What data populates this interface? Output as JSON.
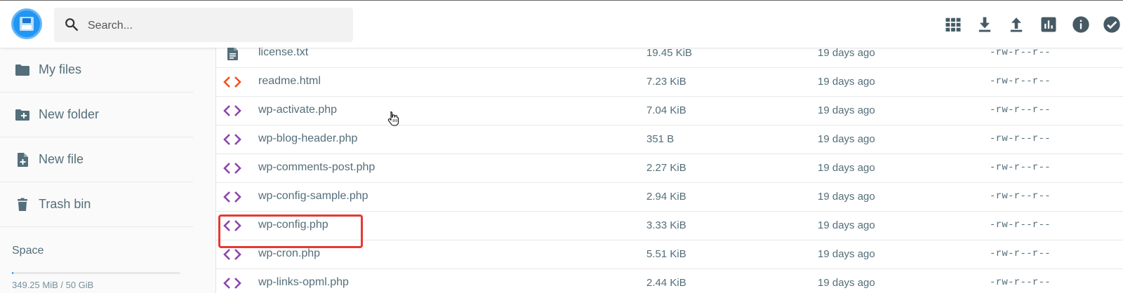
{
  "search": {
    "placeholder": "Search..."
  },
  "toolbar": {
    "buttons": [
      {
        "icon": "grid-view-icon"
      },
      {
        "icon": "download-icon"
      },
      {
        "icon": "upload-icon"
      },
      {
        "icon": "bar-chart-icon"
      },
      {
        "icon": "info-icon"
      },
      {
        "icon": "check-circle-icon"
      }
    ]
  },
  "sidebar": {
    "items": [
      {
        "label": "My files",
        "icon": "folder-icon"
      },
      {
        "label": "New folder",
        "icon": "new-folder-icon"
      },
      {
        "label": "New file",
        "icon": "new-file-icon"
      },
      {
        "label": "Trash bin",
        "icon": "trash-icon"
      }
    ],
    "space": {
      "label": "Space",
      "usage": "349.25 MiB / 50 GiB",
      "used_fraction": 0.007
    }
  },
  "files": [
    {
      "name": "license.txt",
      "size": "19.45 KiB",
      "modified": "19 days ago",
      "perms": "-rw-r--r--",
      "type": "text"
    },
    {
      "name": "readme.html",
      "size": "7.23 KiB",
      "modified": "19 days ago",
      "perms": "-rw-r--r--",
      "type": "html"
    },
    {
      "name": "wp-activate.php",
      "size": "7.04 KiB",
      "modified": "19 days ago",
      "perms": "-rw-r--r--",
      "type": "php"
    },
    {
      "name": "wp-blog-header.php",
      "size": "351 B",
      "modified": "19 days ago",
      "perms": "-rw-r--r--",
      "type": "php"
    },
    {
      "name": "wp-comments-post.php",
      "size": "2.27 KiB",
      "modified": "19 days ago",
      "perms": "-rw-r--r--",
      "type": "php"
    },
    {
      "name": "wp-config-sample.php",
      "size": "2.94 KiB",
      "modified": "19 days ago",
      "perms": "-rw-r--r--",
      "type": "php"
    },
    {
      "name": "wp-config.php",
      "size": "3.33 KiB",
      "modified": "19 days ago",
      "perms": "-rw-r--r--",
      "type": "php"
    },
    {
      "name": "wp-cron.php",
      "size": "5.51 KiB",
      "modified": "19 days ago",
      "perms": "-rw-r--r--",
      "type": "php"
    },
    {
      "name": "wp-links-opml.php",
      "size": "2.44 KiB",
      "modified": "19 days ago",
      "perms": "-rw-r--r--",
      "type": "php"
    }
  ],
  "colors": {
    "accent": "#2196f3",
    "text": "#546e7a",
    "icon_dark": "#455a64",
    "html_icon": "#f4511e",
    "php_icon": "#8e44ad",
    "highlight": "#e53935"
  }
}
